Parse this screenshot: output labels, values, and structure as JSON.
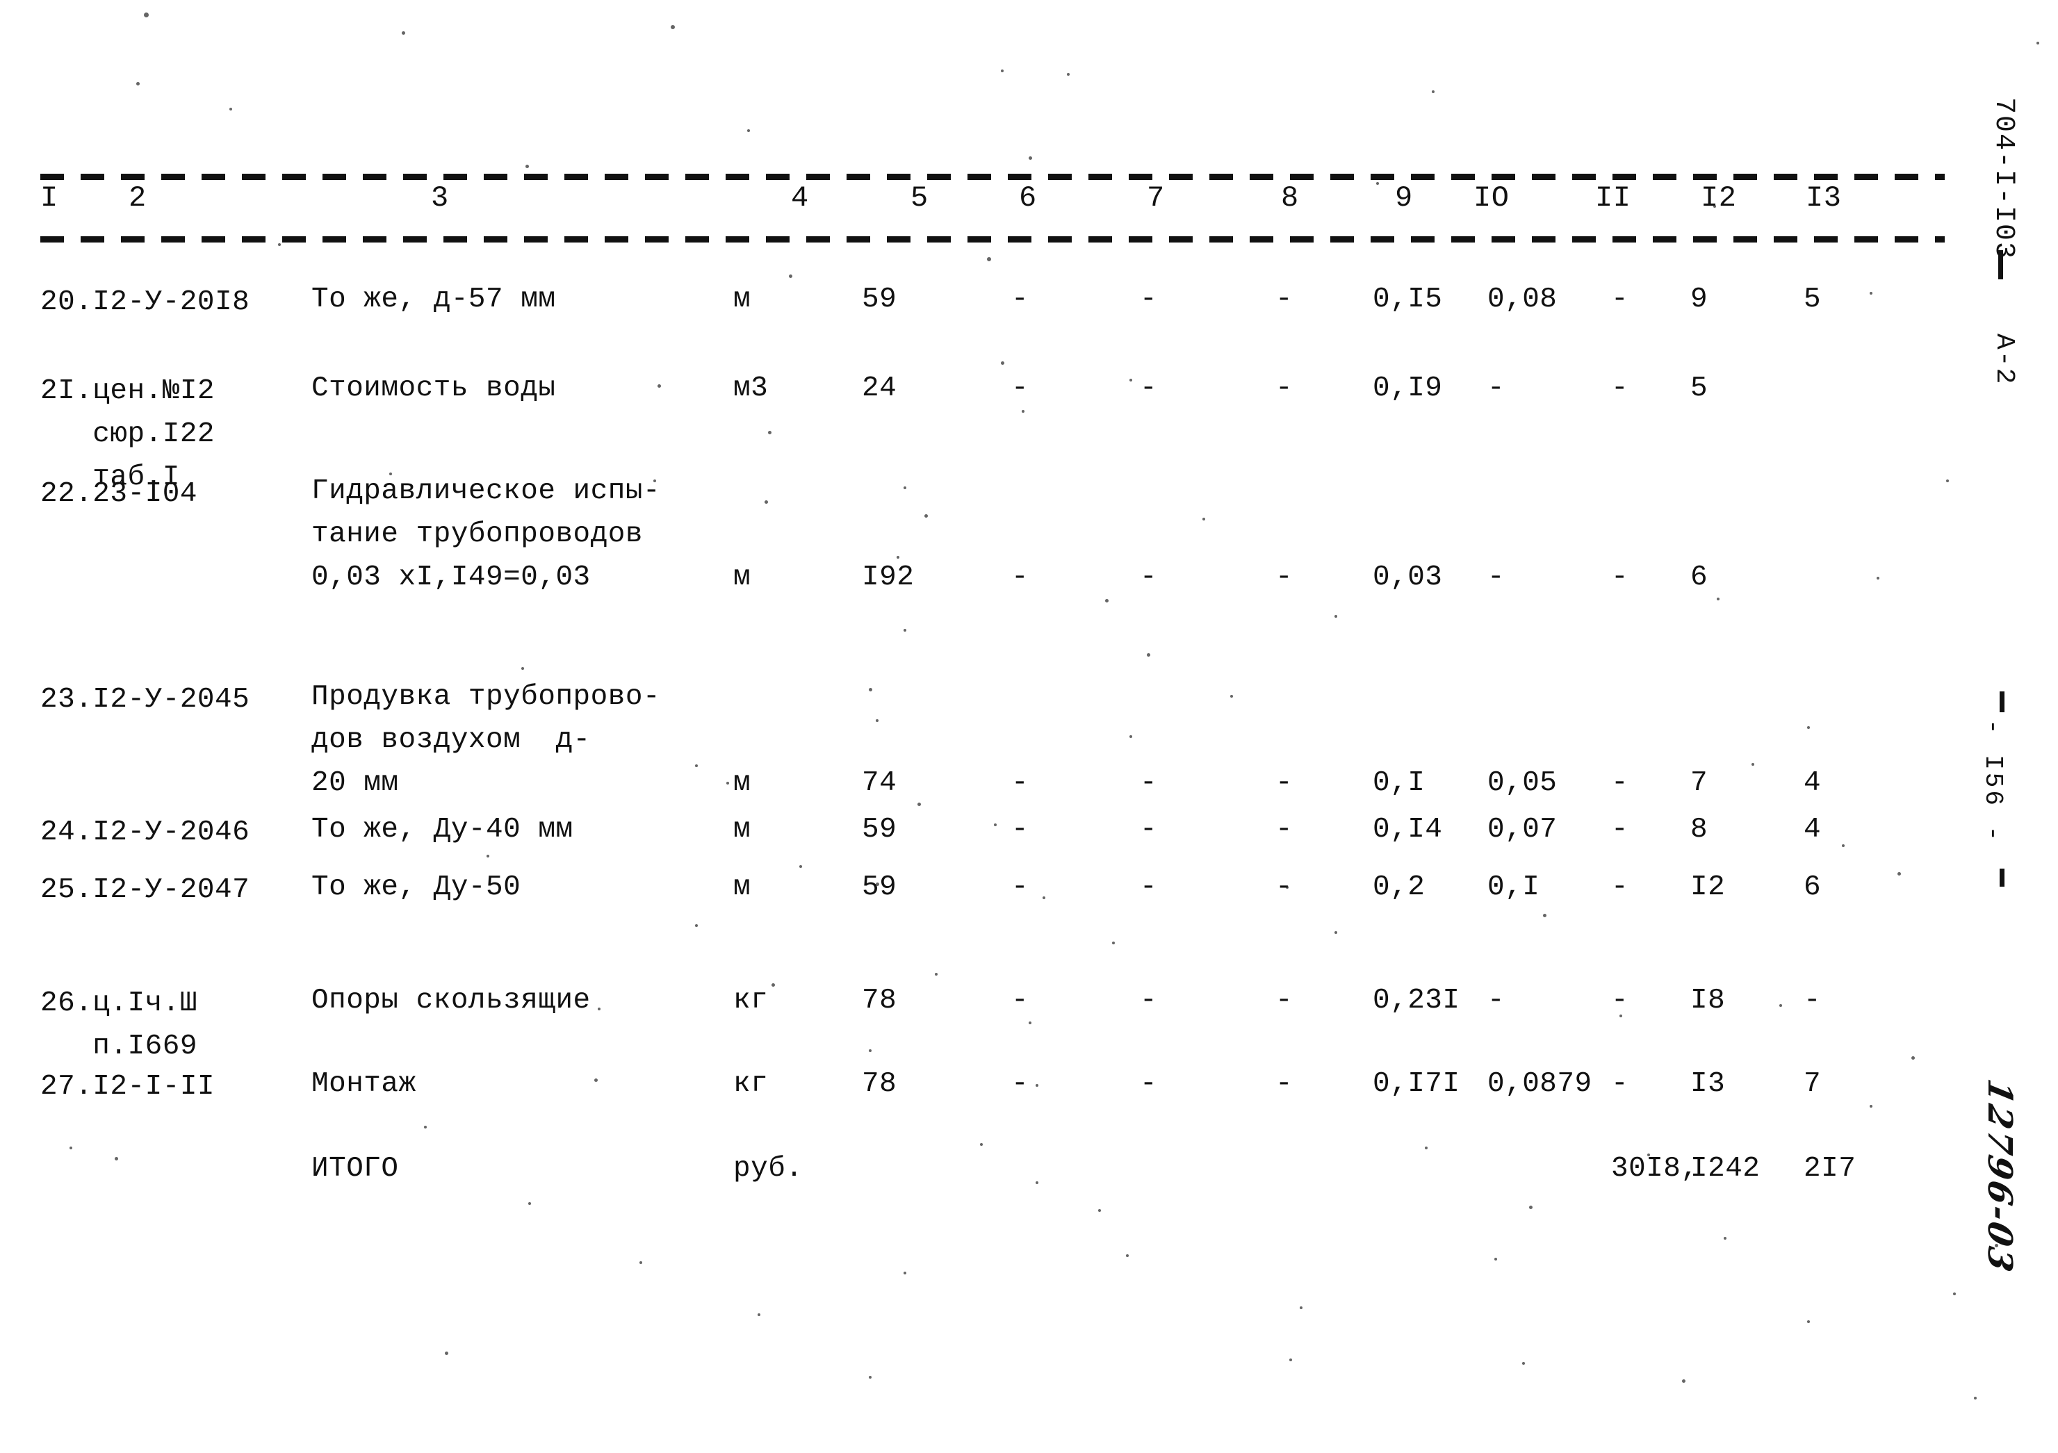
{
  "document": {
    "sheet_code": "704-I-I03",
    "revision_mark": "А-2",
    "page_number": "- I56 -",
    "handwritten_note": "12796-03"
  },
  "table": {
    "column_headers": [
      "I",
      "2",
      "3",
      "4",
      "5",
      "6",
      "7",
      "8",
      "9",
      "IO",
      "II",
      "I2",
      "I3"
    ],
    "rows": [
      {
        "code": "20.I2-У-20I8",
        "description": [
          "То же, д-57 мм"
        ],
        "unit": "м",
        "qty": "59",
        "c6": "-",
        "c7": "-",
        "c8": "-",
        "c9": "0,I5",
        "c10": "0,08",
        "c11": "-",
        "c12": "9",
        "c13": "5"
      },
      {
        "code": "2I.цен.№I2\n   сюр.I22\n   таб.I",
        "description": [
          "Стоимость воды"
        ],
        "unit": "м3",
        "qty": "24",
        "c6": "-",
        "c7": "-",
        "c8": "-",
        "c9": "0,I9",
        "c10": "-",
        "c11": "-",
        "c12": "5",
        "c13": ""
      },
      {
        "code": "22.23-I04",
        "description": [
          "Гидравлическое испы-",
          "тание трубопроводов",
          "0,03 хI,I49=0,03"
        ],
        "unit": "м",
        "qty": "I92",
        "c6": "-",
        "c7": "-",
        "c8": "-",
        "c9": "0,03",
        "c10": "-",
        "c11": "-",
        "c12": "6",
        "c13": ""
      },
      {
        "code": "23.I2-У-2045",
        "description": [
          "Продувка трубопрово-",
          "дов воздухом  д-",
          "20 мм"
        ],
        "unit": "м",
        "qty": "74",
        "c6": "-",
        "c7": "-",
        "c8": "-",
        "c9": "0,I",
        "c10": "0,05",
        "c11": "-",
        "c12": "7",
        "c13": "4"
      },
      {
        "code": "24.I2-У-2046",
        "description": [
          "То же, Ду-40 мм"
        ],
        "unit": "м",
        "qty": "59",
        "c6": "-",
        "c7": "-",
        "c8": "-",
        "c9": "0,I4",
        "c10": "0,07",
        "c11": "-",
        "c12": "8",
        "c13": "4"
      },
      {
        "code": "25.I2-У-2047",
        "description": [
          "То же, Ду-50"
        ],
        "unit": "м",
        "qty": "59",
        "c6": "-",
        "c7": "-",
        "c8": "-",
        "c9": "0,2",
        "c10": "0,I",
        "c11": "-",
        "c12": "I2",
        "c13": "6"
      },
      {
        "code": "26.ц.Iч.Ш\n   п.I669",
        "description": [
          "Опоры скользящие"
        ],
        "unit": "кг",
        "qty": "78",
        "c6": "-",
        "c7": "-",
        "c8": "-",
        "c9": "0,23I",
        "c10": "-",
        "c11": "-",
        "c12": "I8",
        "c13": "-"
      },
      {
        "code": "27.I2-I-II",
        "description": [
          "Монтаж"
        ],
        "unit": "кг",
        "qty": "78",
        "c6": "-",
        "c7": "-",
        "c8": "-",
        "c9": "0,I7I",
        "c10": "0,0879",
        "c11": "-",
        "c12": "I3",
        "c13": "7"
      }
    ],
    "total_row": {
      "label": "ИТОГО",
      "unit": "руб.",
      "c11": "30I8,",
      "c12": "I242",
      "c13": "2I7"
    }
  }
}
